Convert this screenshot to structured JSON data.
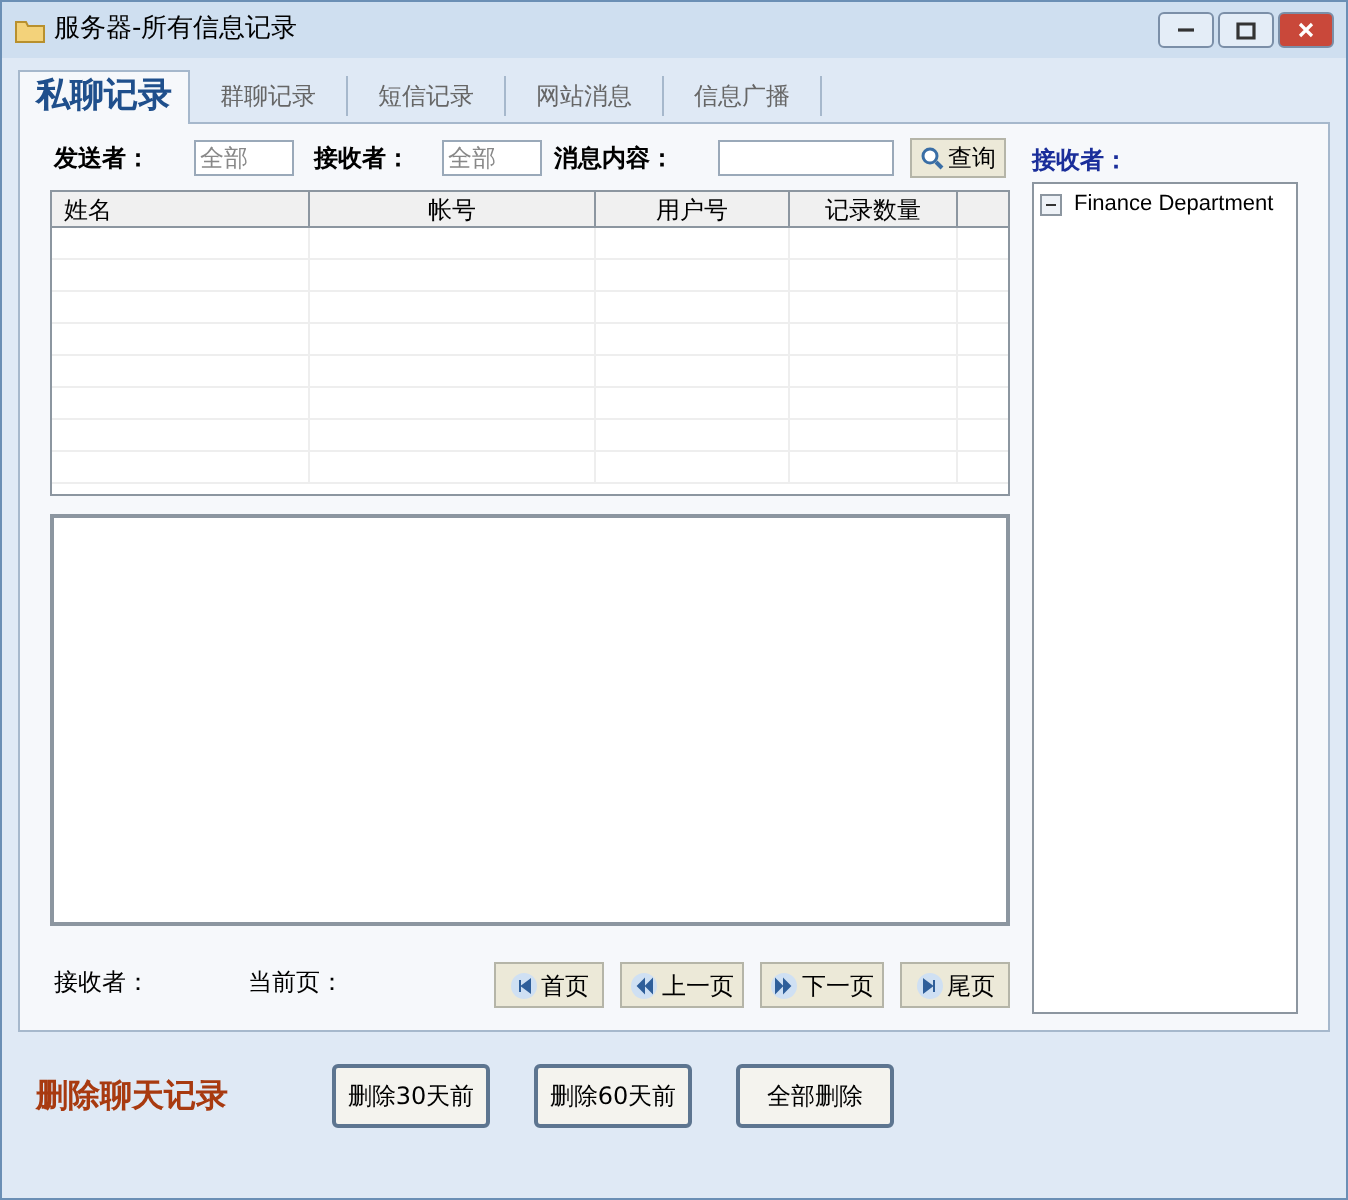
{
  "window": {
    "title": "服务器-所有信息记录"
  },
  "tabs": [
    {
      "label": "私聊记录",
      "selected": true
    },
    {
      "label": "群聊记录",
      "selected": false
    },
    {
      "label": "短信记录",
      "selected": false
    },
    {
      "label": "网站消息",
      "selected": false
    },
    {
      "label": "信息广播",
      "selected": false
    }
  ],
  "filters": {
    "sender": {
      "label": "发送者：",
      "value": "全部"
    },
    "receiver": {
      "label": "接收者：",
      "value": "全部"
    },
    "content": {
      "label": "消息内容："
    },
    "search_button": "查询"
  },
  "table": {
    "columns": [
      "姓名",
      "帐号",
      "用户号",
      "记录数量"
    ]
  },
  "footer": {
    "receiver_label": "接收者：",
    "page_label": "当前页：",
    "pager": [
      {
        "label": "首页",
        "kind": "first"
      },
      {
        "label": "上一页",
        "kind": "prev"
      },
      {
        "label": "下一页",
        "kind": "next"
      },
      {
        "label": "尾页",
        "kind": "last"
      }
    ]
  },
  "tree": {
    "title": "接收者：",
    "items": [
      {
        "label": "Finance Department",
        "expanded": true
      }
    ]
  },
  "delete": {
    "title": "删除聊天记录",
    "buttons": [
      "删除30天前",
      "删除60天前",
      "全部删除"
    ]
  }
}
